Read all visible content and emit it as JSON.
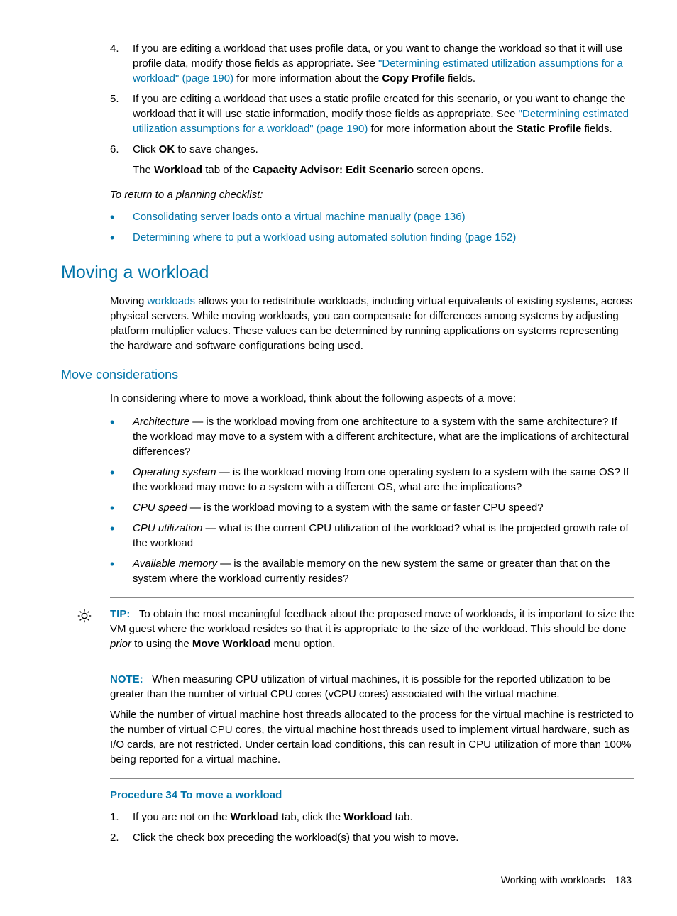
{
  "items": {
    "4": {
      "num": "4.",
      "t1": "If you are editing a workload that uses profile data, or you want to change the workload so that it will use profile data, modify those fields as appropriate. See ",
      "link": "\"Determining estimated utilization assumptions for a workload\" (page 190)",
      "t2": " for more information about the ",
      "bold": "Copy Profile",
      "t3": " fields."
    },
    "5": {
      "num": "5.",
      "t1": "If you are editing a workload that uses a static profile created for this scenario, or you want to change the workload that it will use static information, modify those fields as appropriate. See ",
      "link": "\"Determining estimated utilization assumptions for a workload\" (page 190)",
      "t2": " for more information about the ",
      "bold": "Static Profile",
      "t3": " fields."
    },
    "6": {
      "num": "6.",
      "t1": "Click ",
      "bold": "OK",
      "t2": "  to save changes.",
      "sub_t1": "The ",
      "sub_b1": "Workload",
      "sub_t2": " tab of the ",
      "sub_b2": "Capacity Advisor: Edit Scenario",
      "sub_t3": " screen opens."
    }
  },
  "return_text": "To return to a planning checklist:",
  "return_links": {
    "a": "Consolidating server loads onto a virtual machine manually (page 136)",
    "b": "Determining where to put a workload using automated solution finding (page 152)"
  },
  "h1": "Moving a workload",
  "moving_para": {
    "t1": "Moving ",
    "link": "workloads",
    "t2": " allows you to redistribute workloads, including virtual equivalents of existing systems, across physical servers. While moving workloads, you can compensate for differences among systems by adjusting platform multiplier values. These values can be determined by running applications on systems representing the hardware and software configurations being used."
  },
  "h2": "Move considerations",
  "consider_intro": "In considering where to move a workload, think about the following aspects of a move:",
  "considerations": {
    "arch": {
      "label": "Architecture",
      "text": " — is the workload moving from one architecture to a system with the same architecture? If the workload may move to a system with a different architecture, what are the implications of architectural differences?"
    },
    "os": {
      "label": "Operating system",
      "text": " — is the workload moving from one operating system to a system with the same OS? If the workload may move to a system with a different OS, what are the implications?"
    },
    "cpu_speed": {
      "label": "CPU speed",
      "text": " — is the workload moving to a system with the same or faster CPU speed?"
    },
    "cpu_util": {
      "label": "CPU utilization",
      "text": " — what is the current CPU utilization of the workload? what is the projected growth rate of the workload"
    },
    "mem": {
      "label": "Available memory",
      "text": " — is the available memory on the new system the same or greater than that on the system where the workload currently resides?"
    }
  },
  "tip": {
    "label": "TIP:",
    "t1": "To obtain the most meaningful feedback about the proposed move of workloads, it is important to size the VM guest where the workload resides so that it is appropriate to the size of the workload. This should be done ",
    "italic": "prior",
    "t2": " to using the ",
    "bold": "Move Workload",
    "t3": " menu option."
  },
  "note": {
    "label": "NOTE:",
    "p1": "When measuring CPU utilization of virtual machines, it is possible for the reported utilization to be greater than the number of virtual CPU cores (vCPU cores) associated with the virtual machine.",
    "p2": "While the number of virtual machine host threads allocated to the process for the virtual machine is restricted to the number of virtual CPU cores, the virtual machine host threads used to implement virtual hardware, such as I/O cards, are not restricted. Under certain load conditions, this can result in CPU utilization of more than 100% being reported for a virtual machine."
  },
  "proc": {
    "title": "Procedure 34 To move a workload",
    "s1": {
      "num": "1.",
      "t1": "If you are not on the ",
      "b1": "Workload",
      "t2": " tab, click the ",
      "b2": "Workload",
      "t3": " tab."
    },
    "s2": {
      "num": "2.",
      "text": "Click the check box preceding the workload(s) that you wish to move."
    }
  },
  "footer": {
    "text": "Working with workloads",
    "page": "183"
  }
}
